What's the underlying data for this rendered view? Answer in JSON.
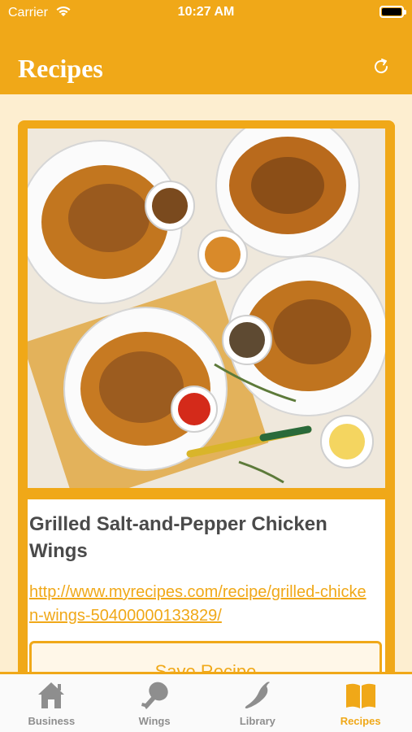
{
  "status_bar": {
    "carrier": "Carrier",
    "time": "10:27 AM"
  },
  "nav": {
    "title": "Recipes",
    "refresh_icon": "refresh-icon"
  },
  "recipe": {
    "image_alt": "grilled-chicken-wings-photo",
    "title": "Grilled Salt-and-Pepper Chicken Wings",
    "url": "http://www.myrecipes.com/recipe/grilled-chicken-wings-50400000133829/",
    "save_label": "Save Recipe"
  },
  "tabs": [
    {
      "label": "Business",
      "icon": "house-icon",
      "active": false
    },
    {
      "label": "Wings",
      "icon": "drumstick-icon",
      "active": false
    },
    {
      "label": "Library",
      "icon": "chili-pepper-icon",
      "active": false
    },
    {
      "label": "Recipes",
      "icon": "open-book-icon",
      "active": true
    }
  ],
  "colors": {
    "accent": "#f0a818",
    "background": "#fdeed0",
    "tab_inactive": "#8e8e8e"
  }
}
